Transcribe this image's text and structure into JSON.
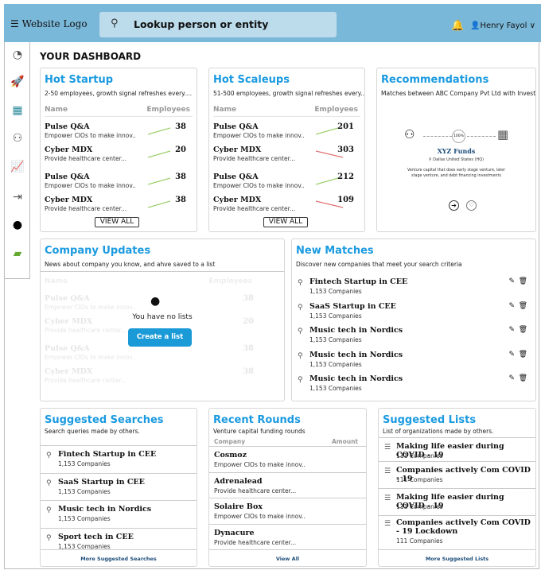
{
  "header": {
    "logo": "Website Logo",
    "search_placeholder": "Lookup person or entity",
    "user": "Henry Fayol",
    "notif_count": "0"
  },
  "sidebar": [
    "speedometer-icon",
    "rocket-icon",
    "building-icon",
    "investors-icon",
    "growth-icon",
    "logout-icon",
    "user-icon",
    "map-icon"
  ],
  "dashboard_title": "YOUR DASHBOARD",
  "hot_startup": {
    "title": "Hot Startup",
    "subtitle": "2-50 employees, growth signal refreshes every....",
    "col_name": "Name",
    "col_emp": "Employees",
    "view_all": "VIEW ALL",
    "rows": [
      {
        "name": "Pulse Q&A",
        "desc": "Empower CIOs to make innov..",
        "value": "38",
        "trend": "up"
      },
      {
        "name": "Cyber MDX",
        "desc": "Provide healthcare center...",
        "value": "20",
        "trend": "up"
      },
      {
        "name": "Pulse Q&A",
        "desc": "Empower CIOs to make innov..",
        "value": "38",
        "trend": "up"
      },
      {
        "name": "Cyber MDX",
        "desc": "Provide healthcare center...",
        "value": "38",
        "trend": "up"
      }
    ]
  },
  "hot_scaleups": {
    "title": "Hot Scaleups",
    "subtitle": "51-500 employees, growth signal refreshes every....",
    "col_name": "Name",
    "col_emp": "Employees",
    "view_all": "VIEW ALL",
    "rows": [
      {
        "name": "Pulse Q&A",
        "desc": "Empower CIOs to make innov..",
        "value": "201",
        "trend": "up"
      },
      {
        "name": "Cyber MDX",
        "desc": "Provide healthcare center...",
        "value": "303",
        "trend": "down"
      },
      {
        "name": "Pulse Q&A",
        "desc": "Empower CIOs to make innov..",
        "value": "212",
        "trend": "up"
      },
      {
        "name": "Cyber MDX",
        "desc": "Provide healthcare center...",
        "value": "109",
        "trend": "down"
      }
    ]
  },
  "recommendations": {
    "title": "Recommendations",
    "subtitle": "Matches between ABC Company Pvt Ltd with Investors",
    "match": "100%",
    "fund": "XYZ Funds",
    "location": "Dallas United States (HQ)",
    "desc": "Venture capital that does early stage venture, later stage venture, and debt financing investments"
  },
  "company_updates": {
    "title": "Company Updates",
    "subtitle": "News about company you know, and ahve saved to a list",
    "empty": "You have no lists",
    "create": "Create a list",
    "col_name": "Name",
    "col_emp": "Employees",
    "rows": [
      {
        "name": "Pulse Q&A",
        "desc": "Empower CIOs to make innov..",
        "value": "38"
      },
      {
        "name": "Cyber MDX",
        "desc": "Provide healthcare center...",
        "value": "20"
      },
      {
        "name": "Pulse Q&A",
        "desc": "Empower CIOs to make innov..",
        "value": "38"
      },
      {
        "name": "Cyber MDX",
        "desc": "Provide healthcare center...",
        "value": "38"
      }
    ]
  },
  "new_matches": {
    "title": "New Matches",
    "subtitle": "Discover new companies that meet your search criteria",
    "rows": [
      {
        "name": "Fintech Startup in CEE",
        "sub": "1,153 Companies"
      },
      {
        "name": "SaaS Startup in CEE",
        "sub": "1,153 Companies"
      },
      {
        "name": "Music tech in Nordics",
        "sub": "1,153 Companies"
      },
      {
        "name": "Music tech in Nordics",
        "sub": "1,153 Companies"
      },
      {
        "name": "Music tech in Nordics",
        "sub": "1,153 Companies"
      }
    ]
  },
  "suggested_searches": {
    "title": "Suggested Searches",
    "subtitle": "Search queries made by others.",
    "footer": "More Suggested Searches",
    "rows": [
      {
        "name": "Fintech Startup in CEE",
        "sub": "1,153 Companies"
      },
      {
        "name": "SaaS Startup in CEE",
        "sub": "1,153 Companies"
      },
      {
        "name": "Music tech in Nordics",
        "sub": "1,153 Companies"
      },
      {
        "name": "Sport tech in CEE",
        "sub": "1,153 Companies"
      }
    ]
  },
  "recent_rounds": {
    "title": "Recent Rounds",
    "subtitle": "Venture capital funding rounds",
    "col_company": "Company",
    "col_amount": "Amount",
    "footer": "View All",
    "rows": [
      {
        "name": "Cosmoz",
        "sub": "Empower CIOs to make innov.."
      },
      {
        "name": "Adrenalead",
        "sub": "Provide healthcare center..."
      },
      {
        "name": "Solaire Box",
        "sub": "Empower CIOs to make innov.."
      },
      {
        "name": "Dynacure",
        "sub": "Provide healthcare center..."
      }
    ]
  },
  "suggested_lists": {
    "title": "Suggested Lists",
    "subtitle": "List of organizations made by others.",
    "footer": "More Suggested Lists",
    "rows": [
      {
        "name": "Making life easier during COVID - 19",
        "sub": "111 Companies"
      },
      {
        "name": "Companies actively Com COVID - 19",
        "sub": "111 Companies"
      },
      {
        "name": "Making life easier during COVID - 19",
        "sub": "111 Companies"
      },
      {
        "name": "Companies actively Com COVID - 19 Lockdown",
        "sub": "111 Companies"
      }
    ]
  },
  "colors": {
    "header": "#7ab8d9",
    "accent": "#1a9ae0",
    "up": "#9ccf6a",
    "down": "#e07070"
  }
}
